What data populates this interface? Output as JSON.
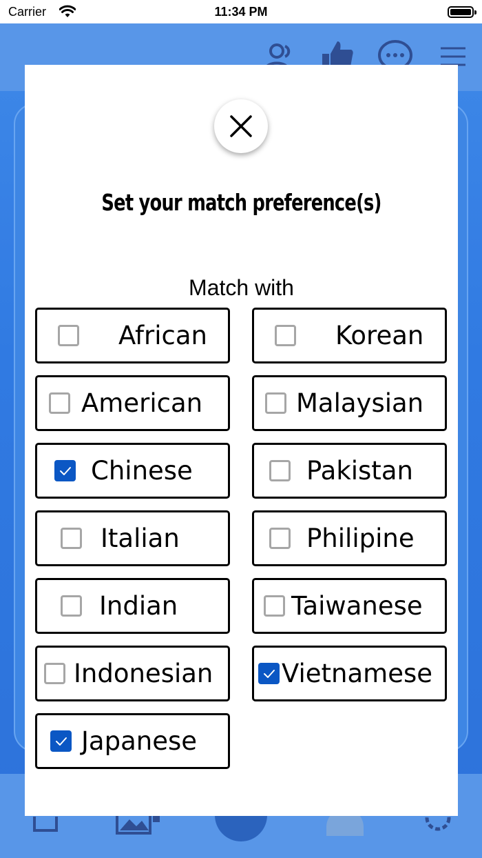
{
  "status_bar": {
    "carrier": "Carrier",
    "time": "11:34 PM"
  },
  "background_app": {
    "header_icons": [
      "people-icon",
      "thumbs-up-icon",
      "chat-bubble-icon",
      "filter-sliders-icon"
    ],
    "tab_icons": [
      "home-icon",
      "gallery-icon",
      "center-action-icon",
      "profile-avatar",
      "settings-gear-icon"
    ]
  },
  "modal": {
    "close_icon": "close-icon",
    "title": "Set your match preference(s)",
    "section_label": "Match with",
    "accent_color": "#0b57c4",
    "options": [
      {
        "label": "African",
        "checked": false
      },
      {
        "label": "Korean",
        "checked": false
      },
      {
        "label": "American",
        "checked": false
      },
      {
        "label": "Malaysian",
        "checked": false
      },
      {
        "label": "Chinese",
        "checked": true
      },
      {
        "label": "Pakistan",
        "checked": false
      },
      {
        "label": "Italian",
        "checked": false
      },
      {
        "label": "Philipine",
        "checked": false
      },
      {
        "label": "Indian",
        "checked": false
      },
      {
        "label": "Taiwanese",
        "checked": false
      },
      {
        "label": "Indonesian",
        "checked": false
      },
      {
        "label": "Vietnamese",
        "checked": true
      },
      {
        "label": "Japanese",
        "checked": true
      }
    ]
  }
}
